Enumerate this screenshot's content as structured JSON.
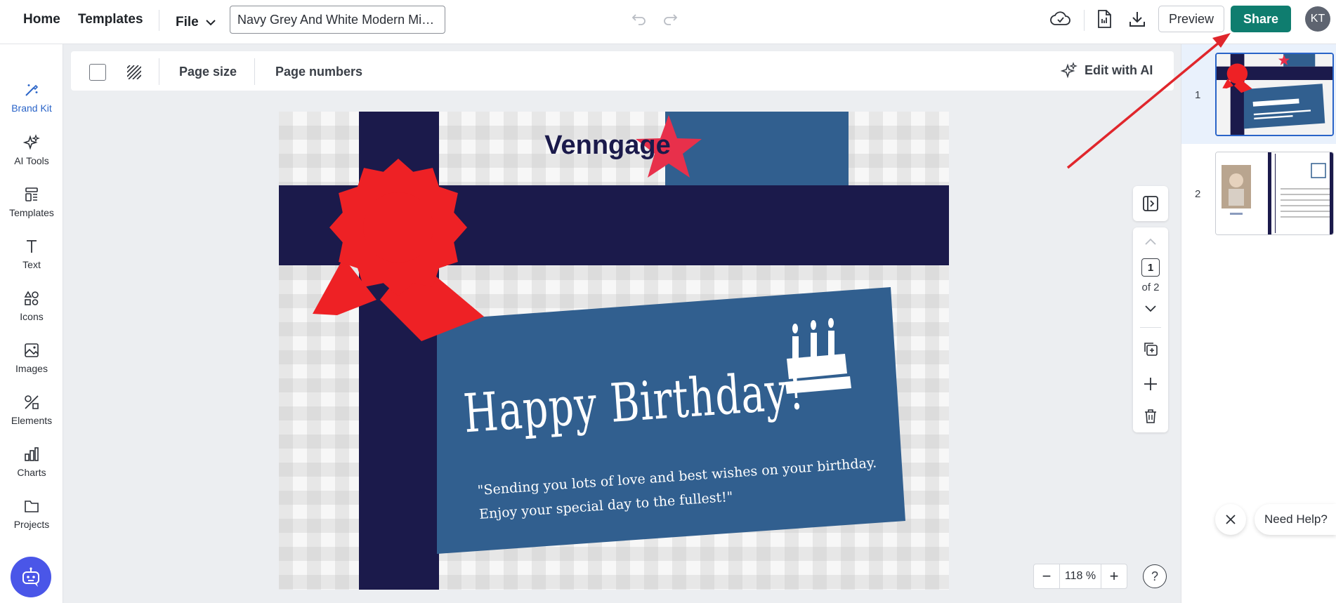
{
  "topbar": {
    "home": "Home",
    "templates": "Templates",
    "file": "File",
    "doc_title": "Navy Grey And White Modern Min...",
    "preview": "Preview",
    "share": "Share",
    "avatar_initials": "KT"
  },
  "sidebar": {
    "items": [
      {
        "label": "Brand Kit",
        "icon": "magic-wand-icon"
      },
      {
        "label": "AI Tools",
        "icon": "sparkles-icon"
      },
      {
        "label": "Templates",
        "icon": "templates-icon"
      },
      {
        "label": "Text",
        "icon": "text-icon"
      },
      {
        "label": "Icons",
        "icon": "shapes-icon"
      },
      {
        "label": "Images",
        "icon": "image-icon"
      },
      {
        "label": "Elements",
        "icon": "elements-icon"
      },
      {
        "label": "Charts",
        "icon": "chart-icon"
      },
      {
        "label": "Projects",
        "icon": "folder-icon"
      }
    ]
  },
  "canvas_toolbar": {
    "page_size": "Page size",
    "page_numbers": "Page numbers",
    "edit_ai": "Edit with AI"
  },
  "design": {
    "logo_text": "Venngage",
    "headline": "Happy Birthday!",
    "message_line1": "\"Sending you lots of love and best wishes on your birthday.",
    "message_line2": "Enjoy your special day to the fullest!\"",
    "colors": {
      "navy": "#1b1a4b",
      "blue": "#315f8f",
      "red": "#ee2125",
      "star": "#e8304b"
    }
  },
  "page_controls": {
    "current_page": "1",
    "of_total": "of 2"
  },
  "zoom": {
    "value": "118 %"
  },
  "pages_panel": {
    "page1_no": "1",
    "page2_no": "2"
  },
  "help": {
    "label": "Need Help?"
  },
  "colors": {
    "accent": "#0f7d6f",
    "selection": "#2a64c8",
    "annotation_arrow": "#e0262c"
  }
}
